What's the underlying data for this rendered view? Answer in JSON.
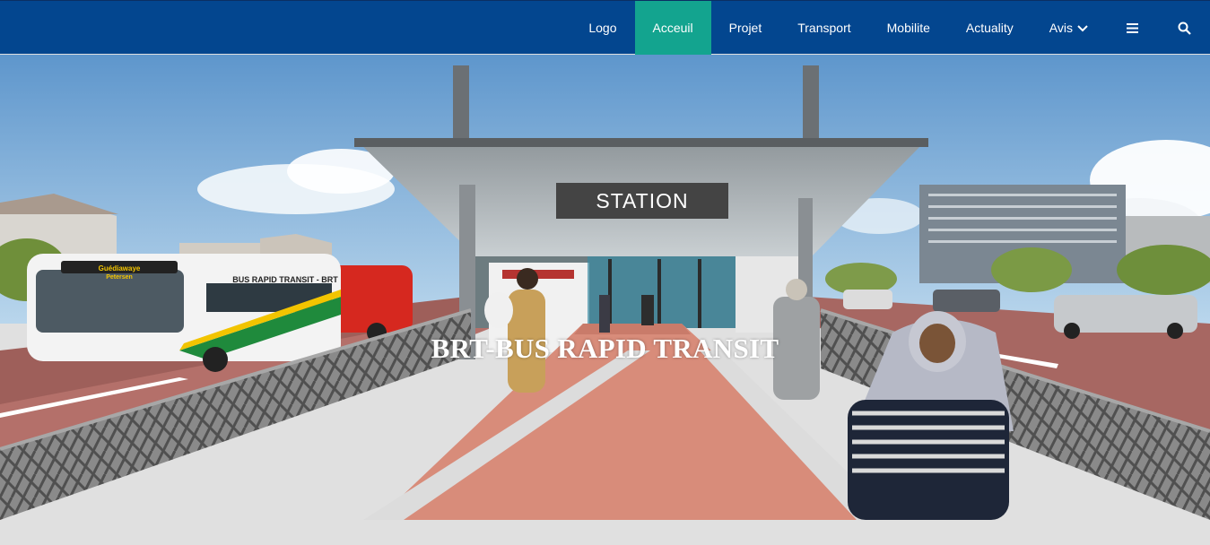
{
  "nav": {
    "items": [
      {
        "label": "Logo"
      },
      {
        "label": "Acceuil"
      },
      {
        "label": "Projet"
      },
      {
        "label": "Transport"
      },
      {
        "label": "Mobilite"
      },
      {
        "label": "Actuality"
      },
      {
        "label": "Avis"
      }
    ],
    "active_index": 1,
    "icons": [
      "menu-icon",
      "search-icon"
    ]
  },
  "hero": {
    "title": "BRT-BUS RAPID TRANSIT",
    "station_sign": "STATION",
    "bus_banner": "BUS RAPID TRANSIT - BRT",
    "bus_destination_line1": "Guédiawaye",
    "bus_destination_line2": "Petersen"
  },
  "colors": {
    "navbar": "#03468f",
    "active_tab": "#13a48f",
    "text": "#ffffff"
  }
}
